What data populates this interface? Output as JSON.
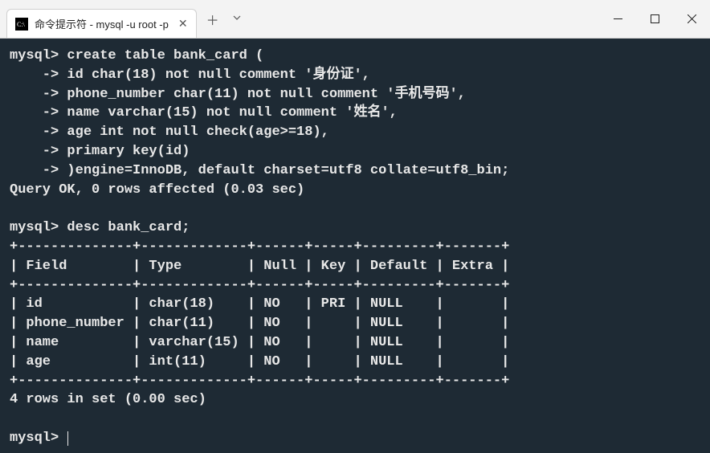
{
  "window": {
    "tab_title": "命令提示符 - mysql  -u root -p"
  },
  "terminal": {
    "l01": "mysql> create table bank_card (",
    "l02": "    -> id char(18) not null comment '身份证',",
    "l03": "    -> phone_number char(11) not null comment '手机号码',",
    "l04": "    -> name varchar(15) not null comment '姓名',",
    "l05": "    -> age int not null check(age>=18),",
    "l06": "    -> primary key(id)",
    "l07": "    -> )engine=InnoDB, default charset=utf8 collate=utf8_bin;",
    "l08": "Query OK, 0 rows affected (0.03 sec)",
    "l09": "",
    "l10": "mysql> desc bank_card;",
    "l11": "+--------------+-------------+------+-----+---------+-------+",
    "l12": "| Field        | Type        | Null | Key | Default | Extra |",
    "l13": "+--------------+-------------+------+-----+---------+-------+",
    "l14": "| id           | char(18)    | NO   | PRI | NULL    |       |",
    "l15": "| phone_number | char(11)    | NO   |     | NULL    |       |",
    "l16": "| name         | varchar(15) | NO   |     | NULL    |       |",
    "l17": "| age          | int(11)     | NO   |     | NULL    |       |",
    "l18": "+--------------+-------------+------+-----+---------+-------+",
    "l19": "4 rows in set (0.00 sec)",
    "l20": "",
    "l21": "mysql> "
  }
}
